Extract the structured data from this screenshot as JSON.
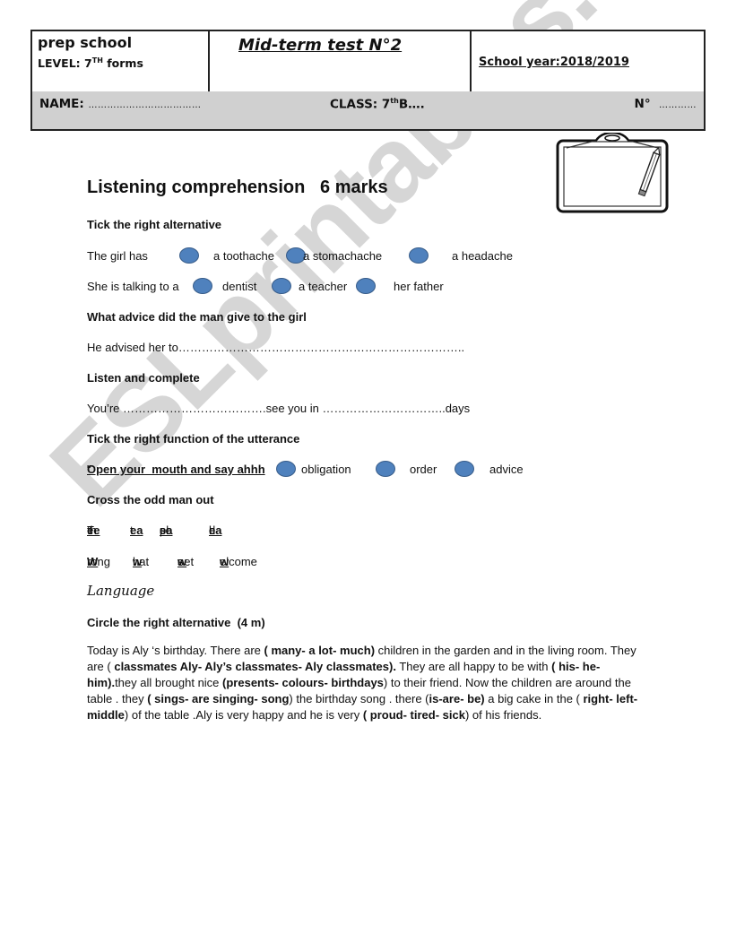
{
  "header": {
    "school": "prep school",
    "level_prefix": "LEVEL: 7",
    "level_sup": "TH",
    "level_suffix": " forms",
    "title": "Mid-term test N°2",
    "school_year": "School year:2018/2019",
    "name_label": "NAME:",
    "name_dots": "………………………………",
    "class_label": "CLASS: 7",
    "class_sup": "th",
    "class_value": "B….",
    "number_label": "N°",
    "number_dots": "…………"
  },
  "listening": {
    "title": "Listening comprehension   6 marks",
    "q1_instruction": "Tick the right alternative",
    "q1a_stem": "The girl has",
    "q1a_options": [
      "a toothache",
      "a stomachache",
      "a headache"
    ],
    "q1b_stem": "She is talking to a",
    "q1b_options": [
      "dentist",
      "a teacher",
      "her father"
    ],
    "q2_instruction": "What advice did the man give to the girl",
    "q2_line": "He advised her to………………………………………………………………..",
    "q3_instruction": "Listen and complete",
    "q3_line": "You’re ……………………………….see you in …………………………..days",
    "q4_instruction": "Tick the right function of the utterance",
    "q4_quote_open": "“",
    "q4_quote": "Open your  mouth and say ahhh",
    "q4_quote_close": "”",
    "q4_options": [
      "obligation",
      "order",
      "advice"
    ],
    "q5_instruction": "Cross the odd man out",
    "q5_row1": [
      {
        "pre": "T",
        "u": "ee",
        "post": "th"
      },
      {
        "pre": "",
        "u": "ea",
        "post": "t"
      },
      {
        "pre": "pl",
        "u": "ea",
        "post": "se"
      },
      {
        "pre": "h",
        "u": "ea",
        "post": "d"
      }
    ],
    "q5_row2": [
      {
        "pre": "",
        "u": "W",
        "post": "rong"
      },
      {
        "pre": "",
        "u": "w",
        "post": "hat"
      },
      {
        "pre": "s",
        "u": "w",
        "post": "eet"
      },
      {
        "pre": "",
        "u": "w",
        "post": "elcome"
      }
    ]
  },
  "language": {
    "title": "Language",
    "instruction": "Circle the right alternative  (4 m)",
    "paragraph": [
      {
        "t": "Today is Aly ‘s birthday. There are "
      },
      {
        "b": "( many- a lot- much)"
      },
      {
        "t": " children in the garden and in the living room. They are ( "
      },
      {
        "b": "classmates Aly- Aly’s classmates- Aly classmates)."
      },
      {
        "t": " They are all happy to be with "
      },
      {
        "b": "( his- he- him)."
      },
      {
        "t": "they all brought nice "
      },
      {
        "b": "(presents- colours- birthdays"
      },
      {
        "t": ") to their friend. Now the children are around the table . they  "
      },
      {
        "b": "( sings- are singing- song"
      },
      {
        "t": ") the birthday song . there ("
      },
      {
        "b": "is-are- be)"
      },
      {
        "t": " a big cake in the ( "
      },
      {
        "b": "right- left- middle"
      },
      {
        "t": ") of the table .Aly  is very  happy and he is very  "
      },
      {
        "b": "( proud- tired- sick"
      },
      {
        "t": ") of his friends."
      }
    ]
  },
  "watermark": "ESLprintables.com",
  "colors": {
    "bubble_fill": "#4f81bd",
    "bubble_stroke": "#385d8a",
    "name_bar": "#d0d0d0"
  }
}
